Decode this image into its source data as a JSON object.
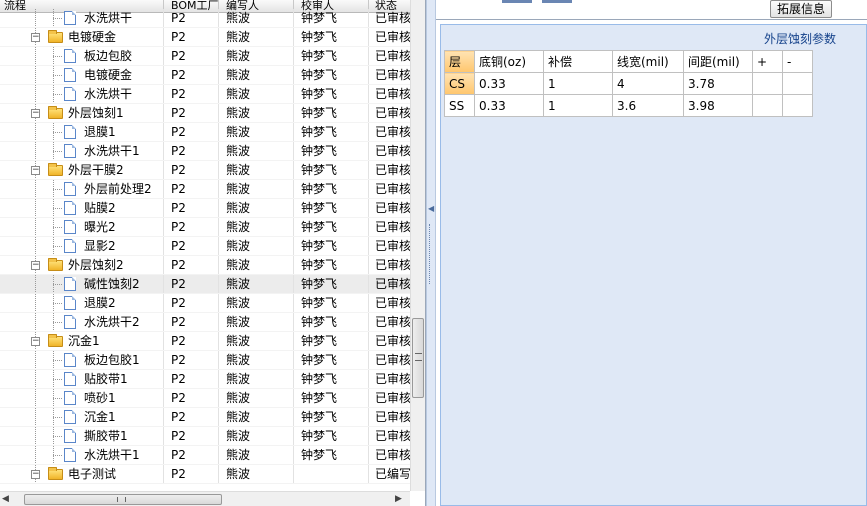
{
  "columns": {
    "flow": "流程",
    "factory": "BOM工厂",
    "editor": "编写人",
    "reviewer": "校审人",
    "status": "状态"
  },
  "rows": [
    {
      "level": 1,
      "type": "doc",
      "name": "水洗烘干",
      "factory": "P2",
      "editor": "熊波",
      "reviewer": "钟梦飞",
      "status": "已审核"
    },
    {
      "level": 0,
      "type": "folder",
      "name": "电镀硬金",
      "factory": "P2",
      "editor": "熊波",
      "reviewer": "钟梦飞",
      "status": "已审核"
    },
    {
      "level": 1,
      "type": "doc",
      "name": "板边包胶",
      "factory": "P2",
      "editor": "熊波",
      "reviewer": "钟梦飞",
      "status": "已审核"
    },
    {
      "level": 1,
      "type": "doc",
      "name": "电镀硬金",
      "factory": "P2",
      "editor": "熊波",
      "reviewer": "钟梦飞",
      "status": "已审核"
    },
    {
      "level": 1,
      "type": "doc",
      "name": "水洗烘干",
      "factory": "P2",
      "editor": "熊波",
      "reviewer": "钟梦飞",
      "status": "已审核"
    },
    {
      "level": 0,
      "type": "folder",
      "name": "外层蚀刻1",
      "factory": "P2",
      "editor": "熊波",
      "reviewer": "钟梦飞",
      "status": "已审核"
    },
    {
      "level": 1,
      "type": "doc",
      "name": "退膜1",
      "factory": "P2",
      "editor": "熊波",
      "reviewer": "钟梦飞",
      "status": "已审核"
    },
    {
      "level": 1,
      "type": "doc",
      "name": "水洗烘干1",
      "factory": "P2",
      "editor": "熊波",
      "reviewer": "钟梦飞",
      "status": "已审核"
    },
    {
      "level": 0,
      "type": "folder",
      "name": "外层干膜2",
      "factory": "P2",
      "editor": "熊波",
      "reviewer": "钟梦飞",
      "status": "已审核"
    },
    {
      "level": 1,
      "type": "doc",
      "name": "外层前处理2",
      "factory": "P2",
      "editor": "熊波",
      "reviewer": "钟梦飞",
      "status": "已审核"
    },
    {
      "level": 1,
      "type": "doc",
      "name": "贴膜2",
      "factory": "P2",
      "editor": "熊波",
      "reviewer": "钟梦飞",
      "status": "已审核"
    },
    {
      "level": 1,
      "type": "doc",
      "name": "曝光2",
      "factory": "P2",
      "editor": "熊波",
      "reviewer": "钟梦飞",
      "status": "已审核"
    },
    {
      "level": 1,
      "type": "doc",
      "name": "显影2",
      "factory": "P2",
      "editor": "熊波",
      "reviewer": "钟梦飞",
      "status": "已审核"
    },
    {
      "level": 0,
      "type": "folder",
      "name": "外层蚀刻2",
      "factory": "P2",
      "editor": "熊波",
      "reviewer": "钟梦飞",
      "status": "已审核"
    },
    {
      "level": 1,
      "type": "doc",
      "name": "碱性蚀刻2",
      "factory": "P2",
      "editor": "熊波",
      "reviewer": "钟梦飞",
      "status": "已审核",
      "selected": true
    },
    {
      "level": 1,
      "type": "doc",
      "name": "退膜2",
      "factory": "P2",
      "editor": "熊波",
      "reviewer": "钟梦飞",
      "status": "已审核"
    },
    {
      "level": 1,
      "type": "doc",
      "name": "水洗烘干2",
      "factory": "P2",
      "editor": "熊波",
      "reviewer": "钟梦飞",
      "status": "已审核"
    },
    {
      "level": 0,
      "type": "folder",
      "name": "沉金1",
      "factory": "P2",
      "editor": "熊波",
      "reviewer": "钟梦飞",
      "status": "已审核"
    },
    {
      "level": 1,
      "type": "doc",
      "name": "板边包胶1",
      "factory": "P2",
      "editor": "熊波",
      "reviewer": "钟梦飞",
      "status": "已审核"
    },
    {
      "level": 1,
      "type": "doc",
      "name": "贴胶带1",
      "factory": "P2",
      "editor": "熊波",
      "reviewer": "钟梦飞",
      "status": "已审核"
    },
    {
      "level": 1,
      "type": "doc",
      "name": "喷砂1",
      "factory": "P2",
      "editor": "熊波",
      "reviewer": "钟梦飞",
      "status": "已审核"
    },
    {
      "level": 1,
      "type": "doc",
      "name": "沉金1",
      "factory": "P2",
      "editor": "熊波",
      "reviewer": "钟梦飞",
      "status": "已审核"
    },
    {
      "level": 1,
      "type": "doc",
      "name": "撕胶带1",
      "factory": "P2",
      "editor": "熊波",
      "reviewer": "钟梦飞",
      "status": "已审核"
    },
    {
      "level": 1,
      "type": "doc",
      "name": "水洗烘干1",
      "factory": "P2",
      "editor": "熊波",
      "reviewer": "钟梦飞",
      "status": "已审核"
    },
    {
      "level": 0,
      "type": "folder",
      "name": "电子测试",
      "factory": "P2",
      "editor": "熊波",
      "reviewer": "",
      "status": "已编写"
    }
  ],
  "right": {
    "extend_button": "拓展信息",
    "panel_title": "外层蚀刻参数",
    "table_headers": [
      "层",
      "底铜(oz)",
      "补偿",
      "线宽(mil)",
      "间距(mil)",
      "+",
      "-"
    ],
    "table_rows": [
      [
        "CS",
        "0.33",
        "1",
        "4",
        "3.78",
        "",
        ""
      ],
      [
        "SS",
        "0.33",
        "1",
        "3.6",
        "3.98",
        "",
        ""
      ]
    ]
  },
  "icons": {
    "expander": "minus-box-icon",
    "folder": "folder-icon",
    "doc": "document-icon"
  }
}
